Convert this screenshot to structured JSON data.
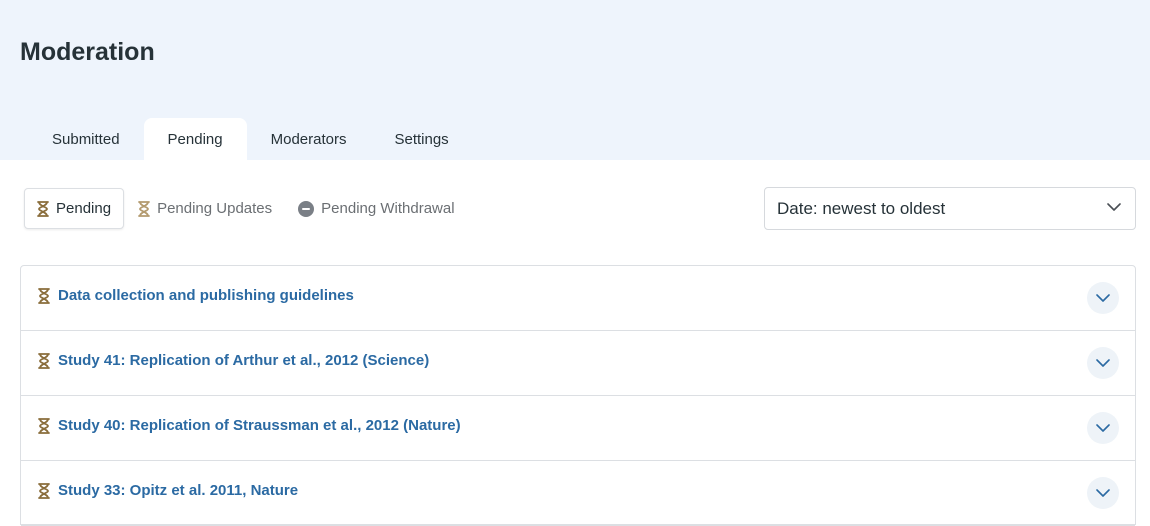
{
  "page": {
    "title": "Moderation"
  },
  "tabs": [
    {
      "label": "Submitted",
      "active": false
    },
    {
      "label": "Pending",
      "active": true
    },
    {
      "label": "Moderators",
      "active": false
    },
    {
      "label": "Settings",
      "active": false
    }
  ],
  "filters": [
    {
      "label": "Pending",
      "icon": "hourglass-icon",
      "active": true
    },
    {
      "label": "Pending Updates",
      "icon": "hourglass-icon",
      "active": false
    },
    {
      "label": "Pending Withdrawal",
      "icon": "minus-circle-icon",
      "active": false
    }
  ],
  "sort": {
    "selected": "Date: newest to oldest"
  },
  "items": [
    {
      "title": "Data collection and publishing guidelines"
    },
    {
      "title": "Study 41: Replication of Arthur et al., 2012 (Science)"
    },
    {
      "title": "Study 40: Replication of Straussman et al., 2012 (Nature)"
    },
    {
      "title": "Study 33: Opitz et al. 2011, Nature"
    }
  ],
  "colors": {
    "header_bg": "#eef4fc",
    "link": "#2b6aa3",
    "pending_icon": "#8a6d3b",
    "withdrawal_icon": "#7a7f86"
  }
}
